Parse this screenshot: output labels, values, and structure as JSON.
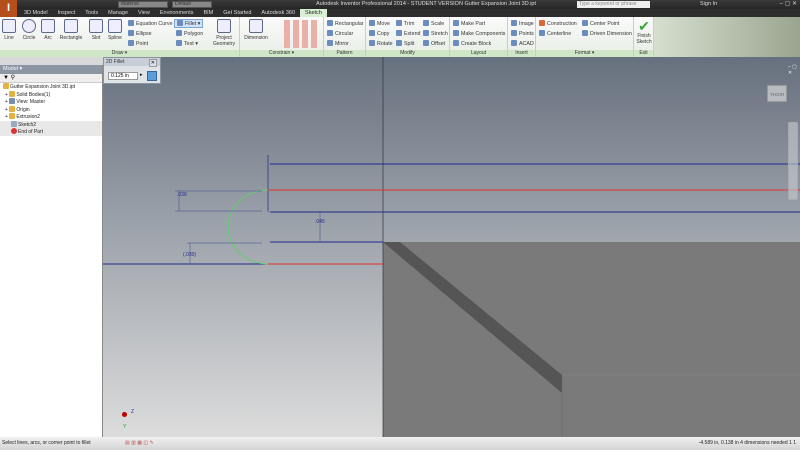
{
  "title_bar": {
    "app_title": "Autodesk Inventor Professional 2014 - STUDENT VERSION   Gutter Expansion Joint 3D.ipt",
    "material": "Material",
    "appearance": "Default",
    "search_placeholder": "Type a keyword or phrase",
    "sign_in": "Sign In",
    "logo": "I"
  },
  "tabs": [
    "3D Model",
    "Inspect",
    "Tools",
    "Manage",
    "View",
    "Environments",
    "BIM",
    "Get Started",
    "Autodesk 360",
    "Sketch"
  ],
  "active_tab": "Sketch",
  "ribbon": {
    "draw": {
      "label": "Draw ▾",
      "big": [
        "Line",
        "Circle",
        "Arc",
        "Rectangle",
        "Slot",
        "Spline"
      ],
      "small": [
        "Equation Curve",
        "Ellipse",
        "Point",
        "Fillet",
        "Polygon",
        "Text"
      ]
    },
    "project_geometry": "Project Geometry",
    "constrain": {
      "label": "Constrain ▾",
      "dimension": "Dimension"
    },
    "pattern": {
      "label": "Pattern",
      "items": [
        "Rectangular",
        "Circular",
        "Mirror"
      ]
    },
    "modify": {
      "label": "Modify",
      "items": [
        "Move",
        "Copy",
        "Rotate",
        "Trim",
        "Extend",
        "Split",
        "Scale",
        "Stretch",
        "Offset"
      ]
    },
    "layout": {
      "label": "Layout",
      "items": [
        "Make Part",
        "Make Components",
        "Create Block"
      ]
    },
    "insert": {
      "label": "Insert",
      "items": [
        "Image",
        "Points",
        "ACAD"
      ]
    },
    "format": {
      "label": "Format ▾",
      "items": [
        "Construction",
        "Centerline",
        "Center Point",
        "Driven Dimension"
      ]
    },
    "exit": {
      "label": "Exit",
      "finish": "Finish Sketch"
    }
  },
  "browser": {
    "header": "Model ▾",
    "tree": [
      "Gutter Expansion Joint 3D.ipt",
      "Solid Bodies(1)",
      "View: Master",
      "Origin",
      "Extrusion2",
      "Sketch2",
      "End of Part"
    ]
  },
  "fillet_dialog": {
    "title": "2D Fillet",
    "value": "0.125 in"
  },
  "dimensions": {
    "d1": ".036",
    "d2": ".045",
    "d3": "(.030)"
  },
  "viewcube_label": "RIGHT",
  "axis": {
    "z": "Z",
    "y": "Y"
  },
  "status": {
    "prompt": "Select lines, arcs, or corner point to fillet",
    "coords": "-4.589 in, 0.138 in  4 dimensions needed   1      1"
  },
  "colors": {
    "ribbon_accent": "#cfe6c7",
    "sketch_line": "#1f2a8c",
    "constraint_line": "#e03030",
    "fillet_preview": "#5fcf6a",
    "solid": "#7a7a7a"
  }
}
